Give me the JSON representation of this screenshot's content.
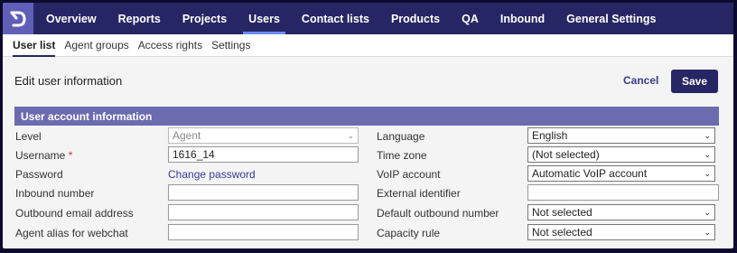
{
  "nav": {
    "items": [
      "Overview",
      "Reports",
      "Projects",
      "Users",
      "Contact lists",
      "Products",
      "QA",
      "Inbound",
      "General Settings"
    ],
    "active": "Users"
  },
  "subnav": {
    "items": [
      "User list",
      "Agent groups",
      "Access rights",
      "Settings"
    ],
    "active": "User list"
  },
  "header": {
    "title": "Edit user information",
    "cancel_label": "Cancel",
    "save_label": "Save"
  },
  "section": {
    "title": "User account information"
  },
  "left_fields": {
    "level": {
      "label": "Level",
      "value": "Agent"
    },
    "username": {
      "label": "Username",
      "required_mark": "*",
      "value": "1616_14"
    },
    "password": {
      "label": "Password",
      "link": "Change password"
    },
    "inbound_number": {
      "label": "Inbound number",
      "value": ""
    },
    "outbound_email": {
      "label": "Outbound email address",
      "value": ""
    },
    "agent_alias": {
      "label": "Agent alias for webchat",
      "value": ""
    }
  },
  "right_fields": {
    "language": {
      "label": "Language",
      "value": "English"
    },
    "time_zone": {
      "label": "Time zone",
      "value": "(Not selected)"
    },
    "voip_account": {
      "label": "VoIP account",
      "value": "Automatic VoIP account"
    },
    "external_identifier": {
      "label": "External identifier",
      "value": ""
    },
    "default_outbound_number": {
      "label": "Default outbound number",
      "value": "Not selected"
    },
    "capacity_rule": {
      "label": "Capacity rule",
      "value": "Not selected"
    }
  },
  "colors": {
    "nav_bg": "#262664",
    "section_bg": "#6b6baf",
    "accent": "#6c8cff"
  }
}
